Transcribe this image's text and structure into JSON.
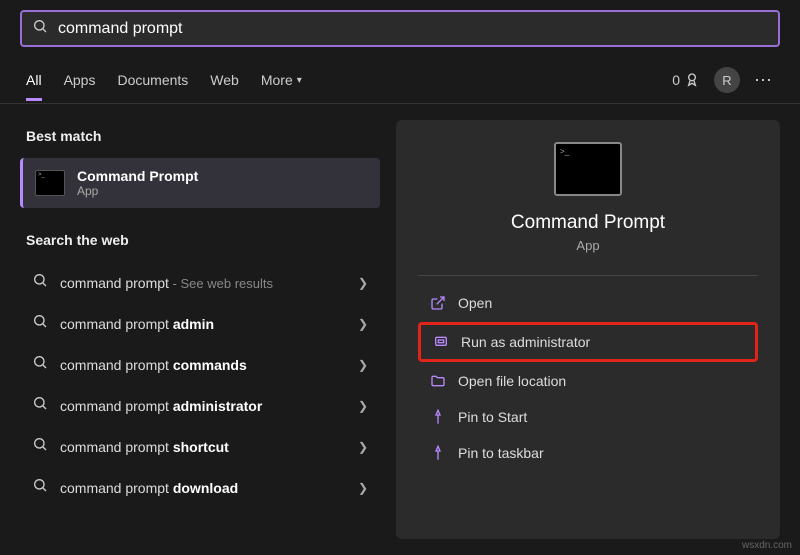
{
  "search": {
    "value": "command prompt"
  },
  "tabs": {
    "all": "All",
    "apps": "Apps",
    "documents": "Documents",
    "web": "Web",
    "more": "More"
  },
  "header": {
    "count": "0",
    "avatar": "R"
  },
  "left": {
    "best_match_header": "Best match",
    "best_match": {
      "title": "Command Prompt",
      "subtitle": "App"
    },
    "web_header": "Search the web",
    "items": [
      {
        "prefix": "command prompt",
        "bold": "",
        "suffix": " - See web results"
      },
      {
        "prefix": "command prompt ",
        "bold": "admin",
        "suffix": ""
      },
      {
        "prefix": "command prompt ",
        "bold": "commands",
        "suffix": ""
      },
      {
        "prefix": "command prompt ",
        "bold": "administrator",
        "suffix": ""
      },
      {
        "prefix": "command prompt ",
        "bold": "shortcut",
        "suffix": ""
      },
      {
        "prefix": "command prompt ",
        "bold": "download",
        "suffix": ""
      }
    ]
  },
  "preview": {
    "title": "Command Prompt",
    "subtitle": "App",
    "actions": {
      "open": "Open",
      "run_admin": "Run as administrator",
      "open_loc": "Open file location",
      "pin_start": "Pin to Start",
      "pin_taskbar": "Pin to taskbar"
    }
  },
  "watermark": "wsxdn.com"
}
